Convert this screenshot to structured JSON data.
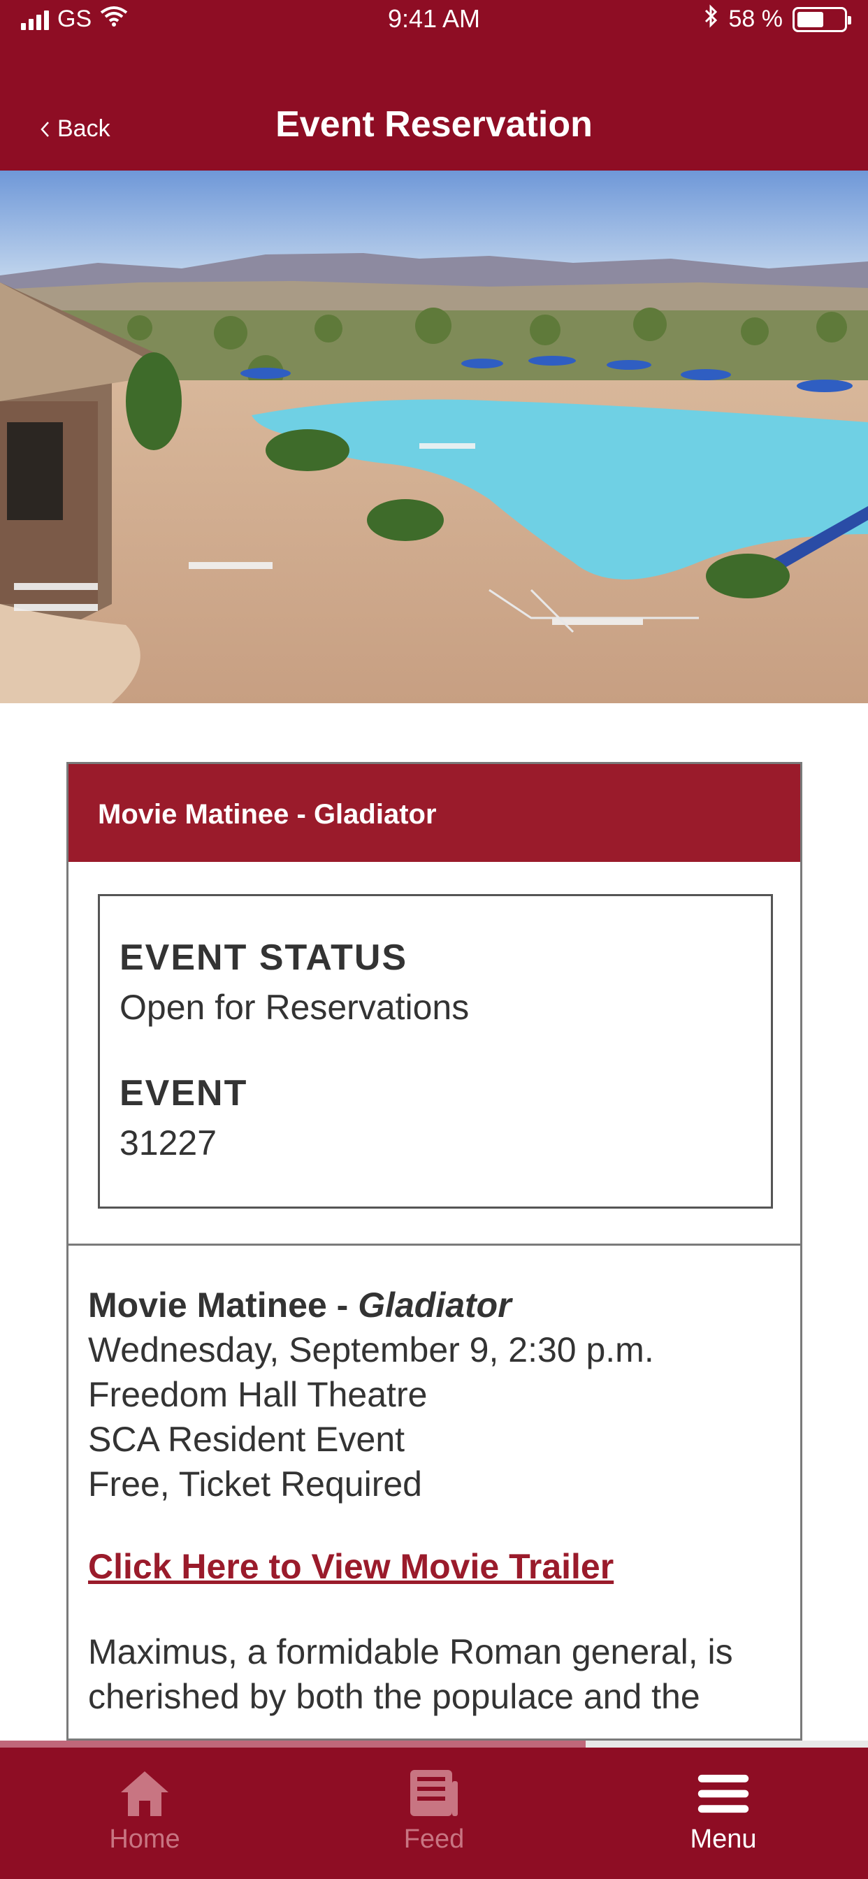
{
  "status_bar": {
    "carrier": "GS",
    "time": "9:41 AM",
    "battery_text": "58 %",
    "battery_level": 0.58
  },
  "nav": {
    "back_label": "Back",
    "title": "Event Reservation"
  },
  "card": {
    "header": "Movie Matinee - Gladiator",
    "status_label": "EVENT STATUS",
    "status_value": "Open for Reservations",
    "event_label": "EVENT",
    "event_value": "31227"
  },
  "details": {
    "title_prefix": "Movie Matinee - ",
    "title_italic": "Gladiator",
    "lines": [
      "Wednesday, September 9, 2:30 p.m.",
      "Freedom Hall Theatre",
      "SCA Resident Event",
      "Free, Ticket Required"
    ],
    "trailer_link": "Click Here to View Movie Trailer",
    "synopsis": "Maximus, a formidable Roman general, is cherished by both the populace and the"
  },
  "scroll_progress": 0.675,
  "tabbar": {
    "items": [
      {
        "label": "Home",
        "icon": "home-icon",
        "active": false
      },
      {
        "label": "Feed",
        "icon": "feed-icon",
        "active": false
      },
      {
        "label": "Menu",
        "icon": "menu-icon",
        "active": true
      }
    ]
  },
  "colors": {
    "brand": "#8e0d24",
    "card_header": "#9a1b2b",
    "link": "#9a1b2b"
  }
}
